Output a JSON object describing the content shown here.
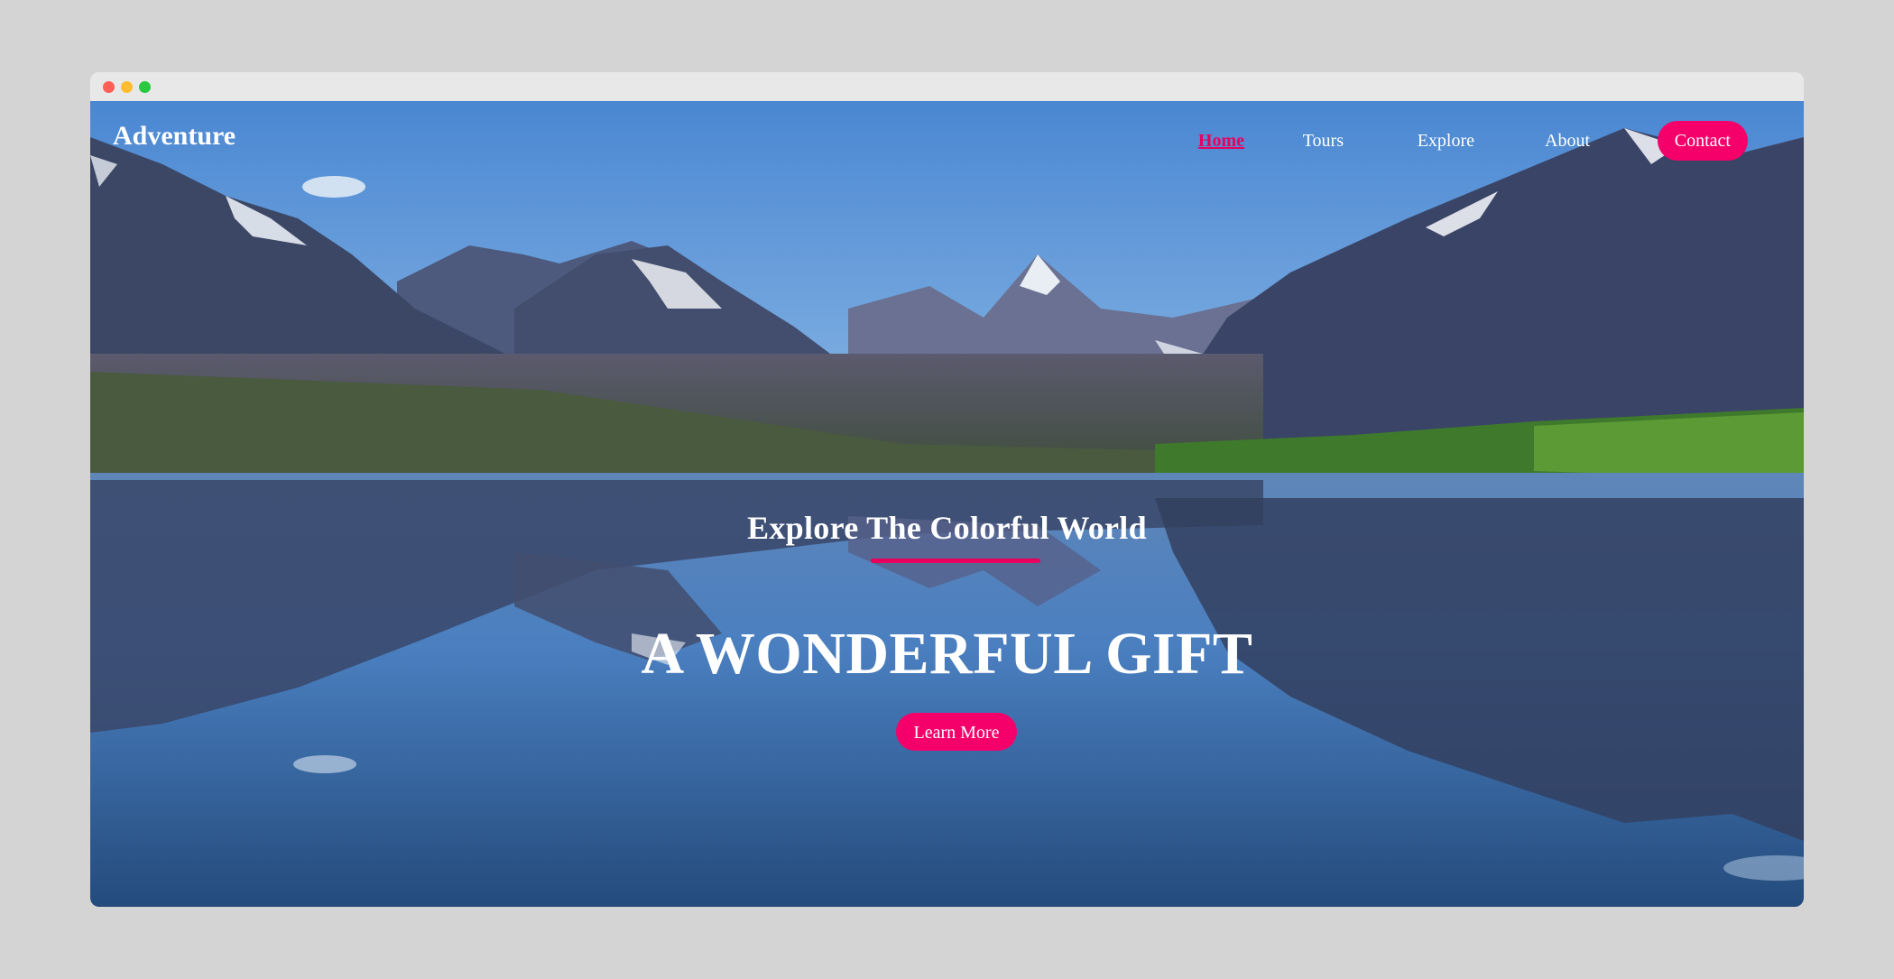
{
  "brand": {
    "name": "Adventure"
  },
  "nav": {
    "items": [
      {
        "label": "Home",
        "active": true
      },
      {
        "label": "Tours",
        "active": false
      },
      {
        "label": "Explore",
        "active": false
      },
      {
        "label": "About",
        "active": false
      }
    ],
    "contact_label": "Contact"
  },
  "hero": {
    "subtitle": "Explore The Colorful World",
    "headline": "A WONDERFUL GIFT",
    "cta_label": "Learn More"
  },
  "colors": {
    "accent": "#f5006a",
    "active_link": "#e8005f",
    "sky": "#4f8fd6",
    "lake": "#2f5f95"
  },
  "icons": {
    "window_controls": [
      "close-dot",
      "minimize-dot",
      "maximize-dot"
    ]
  }
}
